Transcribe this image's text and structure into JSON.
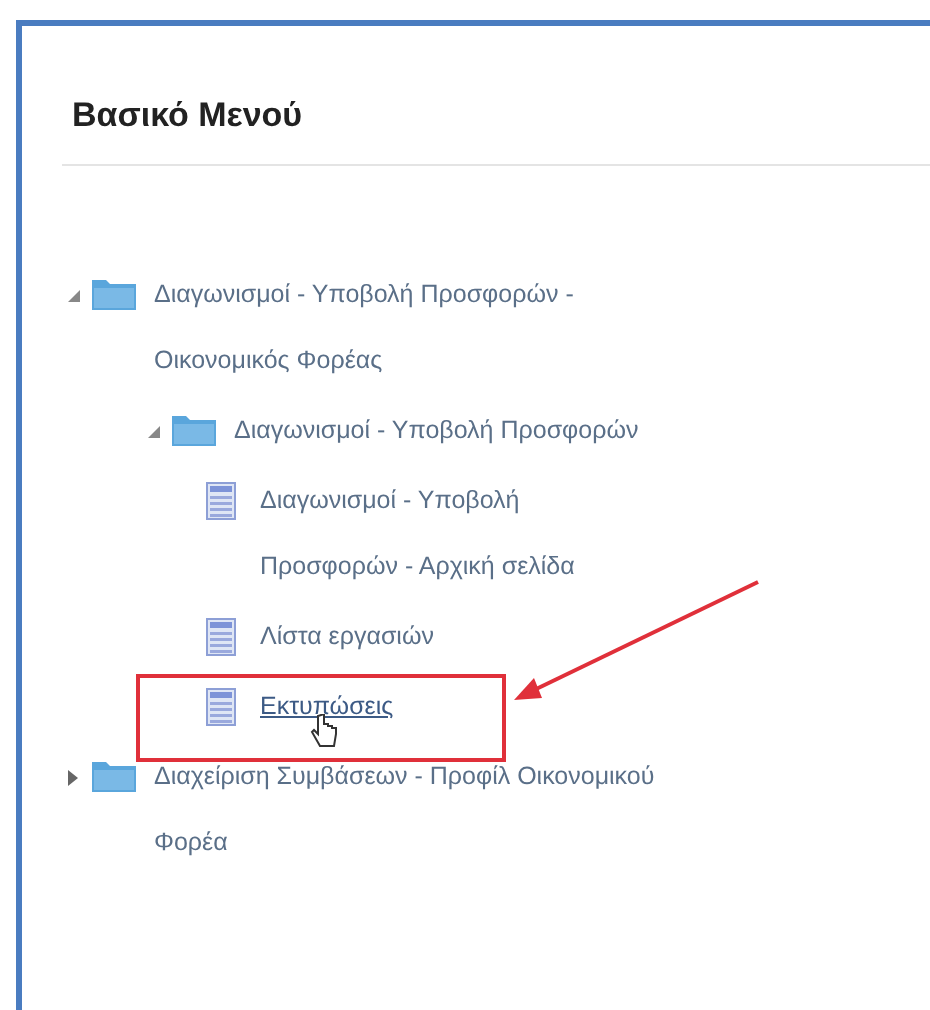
{
  "panel": {
    "title": "Βασικό Μενού"
  },
  "tree": [
    {
      "kind": "folder",
      "label": "Διαγωνισμοί - Υποβολή Προσφορών - Οικονομικός Φορέας",
      "expanded": true,
      "highlighted": false,
      "children": [
        {
          "kind": "folder",
          "label": "Διαγωνισμοί - Υποβολή Προσφορών",
          "expanded": true,
          "highlighted": false,
          "children": [
            {
              "kind": "page",
              "label": "Διαγωνισμοί - Υποβολή Προσφορών - Αρχική σελίδα",
              "highlighted": false
            },
            {
              "kind": "page",
              "label": "Λίστα εργασιών",
              "highlighted": false
            },
            {
              "kind": "page",
              "label": "Εκτυπώσεις",
              "highlighted": true
            }
          ]
        }
      ]
    },
    {
      "kind": "folder",
      "label": "Διαχείριση Συμβάσεων - Προφίλ Οικονομικού Φορέα",
      "expanded": false,
      "highlighted": false
    }
  ]
}
